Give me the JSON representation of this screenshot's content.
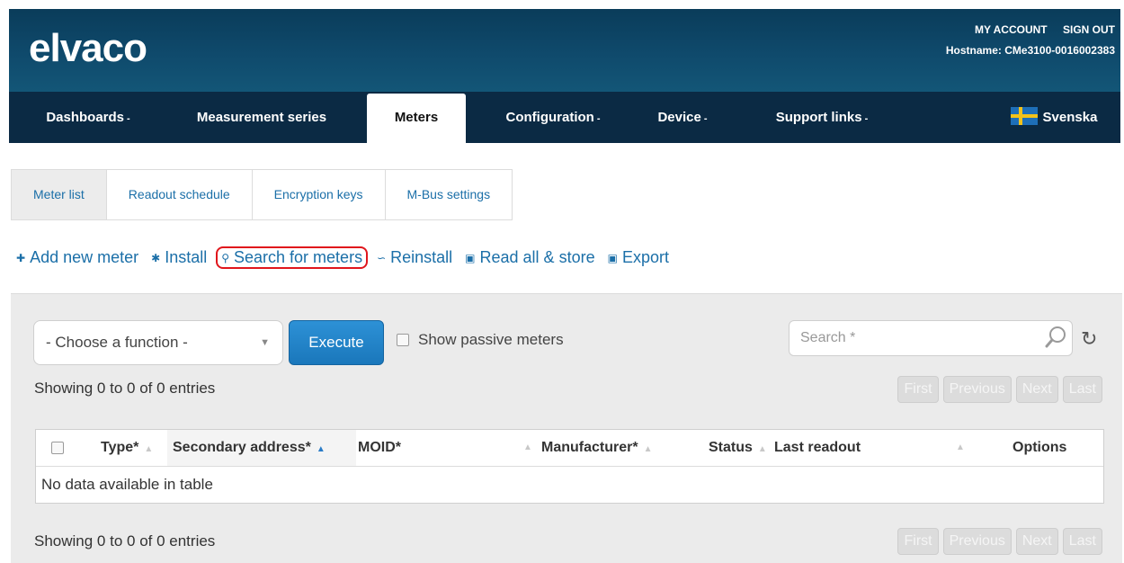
{
  "header": {
    "logo": "elvaco",
    "my_account": "MY ACCOUNT",
    "sign_out": "SIGN OUT",
    "hostname": "Hostname: CMe3100-0016002383"
  },
  "nav": {
    "dashboards": "Dashboards",
    "measurement_series": "Measurement series",
    "meters": "Meters",
    "configuration": "Configuration",
    "device": "Device",
    "support_links": "Support links",
    "language": "Svenska"
  },
  "subtabs": [
    "Meter list",
    "Readout schedule",
    "Encryption keys",
    "M-Bus settings"
  ],
  "actions": {
    "add_new_meter": "Add new meter",
    "install": "Install",
    "search_for_meters": "Search for meters",
    "reinstall": "Reinstall",
    "read_all_store": "Read all & store",
    "export": "Export"
  },
  "toolbar": {
    "function_select": "- Choose a function -",
    "execute": "Execute",
    "show_passive": "Show passive meters",
    "search_placeholder": "Search *"
  },
  "pagination": {
    "info": "Showing 0 to 0 of 0 entries",
    "first": "First",
    "previous": "Previous",
    "next": "Next",
    "last": "Last"
  },
  "table": {
    "columns": [
      "Type*",
      "Secondary address*",
      "MOID*",
      "Manufacturer*",
      "Status",
      "Last readout",
      "Options"
    ],
    "empty": "No data available in table"
  }
}
